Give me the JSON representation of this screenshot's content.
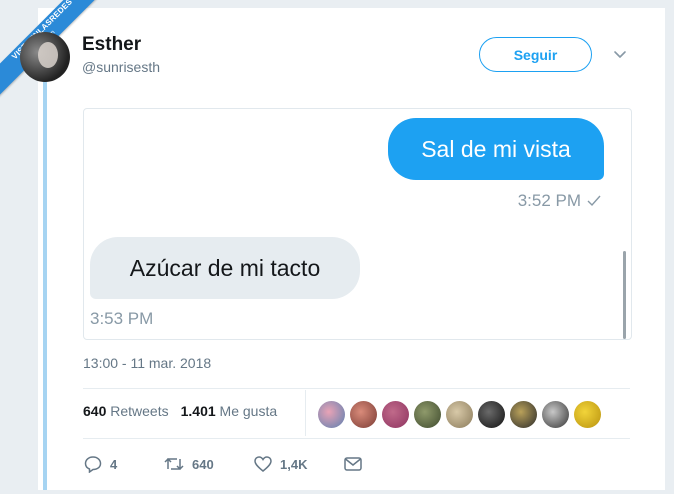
{
  "watermark": {
    "text": "VISTOENLASREDES",
    "sub": ".com"
  },
  "tweet": {
    "author_name": "Esther",
    "author_handle": "@sunrisesth",
    "follow_label": "Seguir",
    "timestamp": "13:00 - 11 mar. 2018",
    "embedded_chat": {
      "sent_message": "Sal de mi vista",
      "sent_time": "3:52 PM",
      "received_message": "Azúcar de mi tacto",
      "received_time": "3:53 PM"
    },
    "stats": {
      "retweets_count": "640",
      "retweets_label": "Retweets",
      "likes_count": "1.401",
      "likes_label": "Me gusta"
    },
    "actions": {
      "replies": "4",
      "retweets": "640",
      "likes": "1,4K"
    },
    "colors": {
      "accent": "#1da1f2",
      "sent_bubble": "#1da1f2",
      "received_bubble": "#e6ecf0"
    }
  }
}
